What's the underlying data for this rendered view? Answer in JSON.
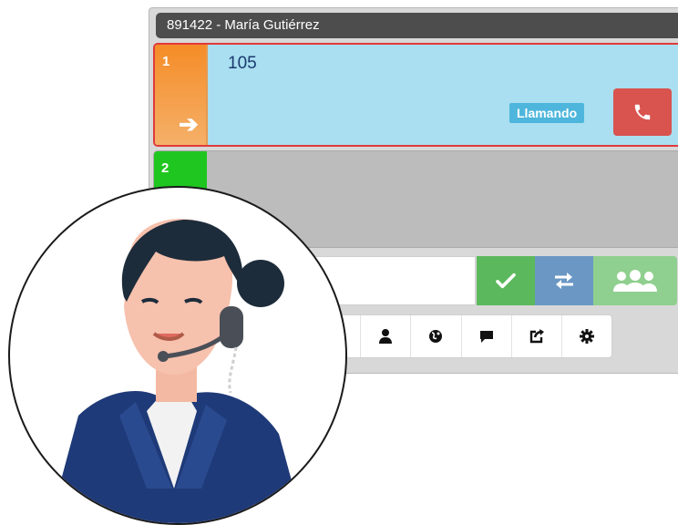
{
  "window": {
    "title": "891422 - María Gutiérrez"
  },
  "lines": [
    {
      "number_label": "1",
      "dialed_number": "105",
      "status": "Llamando"
    },
    {
      "number_label": "2"
    }
  ],
  "icons": {
    "line1": "arrow-right-icon",
    "hangup": "phone-icon",
    "accept": "check-icon",
    "transfer": "transfer-icon",
    "conference": "users-icon",
    "toolbar": [
      "contact-icon",
      "globe-icon",
      "chat-icon",
      "share-icon",
      "gear-icon"
    ]
  },
  "colors": {
    "title_bar": "#4d4d4d",
    "active_line_border": "#e03a3a",
    "active_line_bg": "#a9dff0",
    "line1_tab": "#f58c27",
    "line2_tab": "#1fc61f",
    "status_badge": "#4eb6dc",
    "hangup": "#d9534f",
    "accept": "#5cb85c",
    "transfer": "#6a97c4",
    "conference": "#8fcf8f"
  }
}
